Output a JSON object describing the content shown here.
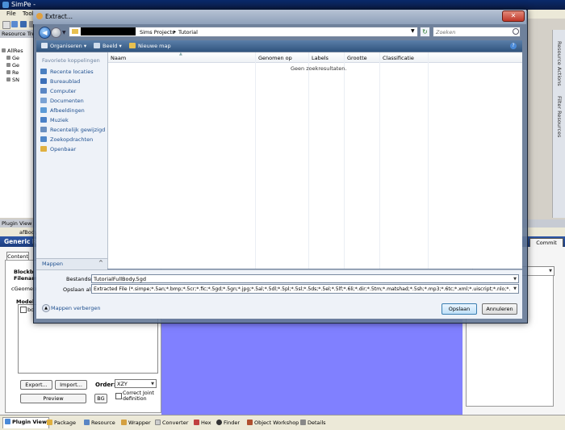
{
  "app": {
    "title": "SimPe -",
    "menu": [
      "File",
      "Tools"
    ],
    "tree_header": "Resource Tree",
    "tree_items": [
      "AllRes",
      "Ge",
      "Ge",
      "Re",
      "SN"
    ],
    "right_strip": [
      "Resource Actions",
      "Filter Resources"
    ],
    "plugin_view_label": "Plugin View",
    "plugin_tab": "afBody",
    "generic_header": "Generic R",
    "commit_label": "Commit",
    "content_tab": "Content",
    "blockname_label": "Blockb",
    "filename_label": "Filenam",
    "cgeometry_label": "cGeometr",
    "models_label": "Model",
    "list_item": "bo",
    "export_label": "Export...",
    "import_label": "Import...",
    "order_label": "Order:",
    "order_value": "XZY",
    "preview_label": "Preview",
    "bg_label": "BG",
    "correct_joint_label1": "Correct Joint",
    "correct_joint_label2": "definition",
    "bottom_tabs": [
      "Plugin View",
      "Package",
      "Resource",
      "Wrapper",
      "Converter",
      "Hex",
      "Finder",
      "Object Workshop",
      "Details"
    ],
    "preview_color": "#8080ff"
  },
  "dialog": {
    "title": "Extract...",
    "close_glyph": "✕",
    "breadcrumb": [
      "Sims Projects",
      "Tutorial"
    ],
    "search_placeholder": "Zoeken",
    "toolbar": {
      "organize": "Organiseren",
      "view": "Beeld",
      "new_folder": "Nieuwe map"
    },
    "favorites_header": "Favoriete koppelingen",
    "favorites": [
      {
        "label": "Recente locaties",
        "color": "#4a7fc0"
      },
      {
        "label": "Bureaublad",
        "color": "#3b6fb8"
      },
      {
        "label": "Computer",
        "color": "#5a86c4"
      },
      {
        "label": "Documenten",
        "color": "#7aa2d4"
      },
      {
        "label": "Afbeeldingen",
        "color": "#5c9ad6"
      },
      {
        "label": "Muziek",
        "color": "#4a80c6"
      },
      {
        "label": "Recentelijk gewijzigd",
        "color": "#6a8fc0"
      },
      {
        "label": "Zoekopdrachten",
        "color": "#4f86c8"
      },
      {
        "label": "Openbaar",
        "color": "#e0b040"
      }
    ],
    "folders_label": "Mappen",
    "columns": [
      "Naam",
      "Genomen op",
      "Labels",
      "Grootte",
      "Classificatie"
    ],
    "empty_message": "Geen zoekresultaten.",
    "filename_label": "Bestandsnaam:",
    "filename_value": "TutorialFullBody.5gd",
    "filetype_label": "Opslaan als:",
    "filetype_value": "Extracted File (*.simpe;*.5an;*.bmp;*.5cr;*.fic;*.5gd;*.5gn;*.jpg;*.5al;*.5dl;*.5pl;*.5sl;*.5ds;*.5el;*.5lf;*.6li;*.dir;*.5tm;*.matshad;*.5sh;*.mp3;*.6tc;*.xml;*.uiscript;*.nlo;*.5cs;*.5sc)",
    "hide_folders": "Mappen verbergen",
    "save_label": "Opslaan",
    "cancel_label": "Annuleren"
  }
}
